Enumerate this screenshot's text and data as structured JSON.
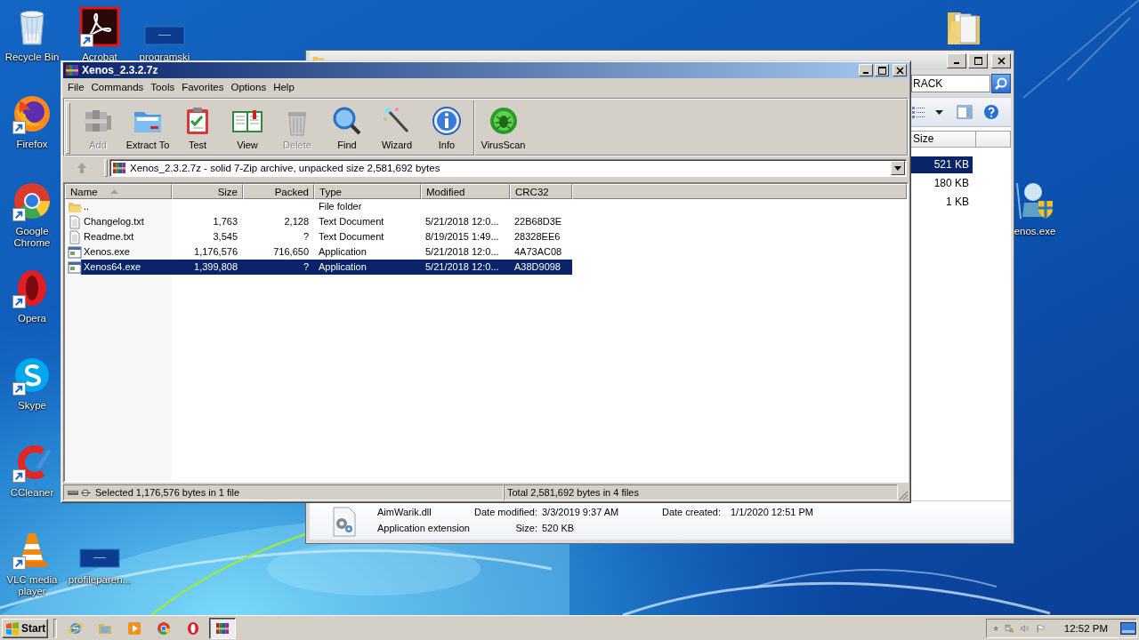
{
  "desktop": {
    "icons": [
      {
        "label": "Recycle Bin",
        "kind": "recycle",
        "shortcut": false
      },
      {
        "label": "Acrobat",
        "kind": "acrobat",
        "shortcut": true
      },
      {
        "label": "programski",
        "kind": "blank",
        "shortcut": false
      },
      {
        "label": "Firefox",
        "kind": "firefox",
        "shortcut": true
      },
      {
        "label": "Google Chrome",
        "kind": "chrome",
        "shortcut": true
      },
      {
        "label": "Opera",
        "kind": "opera",
        "shortcut": true
      },
      {
        "label": "Skype",
        "kind": "skype",
        "shortcut": true
      },
      {
        "label": "CCleaner",
        "kind": "ccleaner",
        "shortcut": true
      },
      {
        "label": "VLC media player",
        "kind": "vlc",
        "shortcut": true
      },
      {
        "label": "profileparen...",
        "kind": "blank",
        "shortcut": false
      },
      {
        "kind": "folder",
        "shortcut": false
      },
      {
        "label": "enos.exe",
        "kind": "figure",
        "shortcut": false
      }
    ]
  },
  "background_window": {
    "search": {
      "value": "RACK"
    },
    "columns": [
      "Size"
    ],
    "rows": [
      {
        "size": "521 KB",
        "selected": true
      },
      {
        "size": "180 KB",
        "selected": false
      },
      {
        "size": "1 KB",
        "selected": false
      }
    ],
    "details": {
      "name": "AimWarik.dll",
      "type": "Application extension",
      "fields": [
        {
          "label": "Date modified:",
          "value": "3/3/2019 9:37 AM"
        },
        {
          "label": "Date created:",
          "value": "1/1/2020 12:51 PM"
        },
        {
          "label": "Size:",
          "value": "520 KB"
        }
      ]
    }
  },
  "window": {
    "title": "Xenos_2.3.2.7z",
    "menu": [
      "File",
      "Commands",
      "Tools",
      "Favorites",
      "Options",
      "Help"
    ],
    "toolbar": [
      {
        "label": "Add",
        "kind": "add",
        "disabled": true,
        "separator_before": false
      },
      {
        "label": "Extract To",
        "kind": "extract",
        "disabled": false,
        "separator_before": false
      },
      {
        "label": "Test",
        "kind": "test",
        "disabled": false,
        "separator_before": false
      },
      {
        "label": "View",
        "kind": "view",
        "disabled": false,
        "separator_before": false
      },
      {
        "label": "Delete",
        "kind": "delete",
        "disabled": true,
        "separator_before": false
      },
      {
        "label": "Find",
        "kind": "find",
        "disabled": false,
        "separator_before": false
      },
      {
        "label": "Wizard",
        "kind": "wizard",
        "disabled": false,
        "separator_before": false
      },
      {
        "label": "Info",
        "kind": "info",
        "disabled": false,
        "separator_before": false
      },
      {
        "label": "VirusScan",
        "kind": "virusscan",
        "disabled": false,
        "separator_before": true
      }
    ],
    "address": "Xenos_2.3.2.7z - solid 7-Zip archive, unpacked size 2,581,692 bytes",
    "columns": [
      {
        "label": "Name",
        "kind": "text",
        "sorted": true
      },
      {
        "label": "Size",
        "kind": "number",
        "sorted": false
      },
      {
        "label": "Packed",
        "kind": "number",
        "sorted": false
      },
      {
        "label": "Type",
        "kind": "text",
        "sorted": false
      },
      {
        "label": "Modified",
        "kind": "text",
        "sorted": false
      },
      {
        "label": "CRC32",
        "kind": "text",
        "sorted": false
      }
    ],
    "rows": [
      {
        "kind": "folder",
        "name": "..",
        "type": "File folder",
        "selected": false
      },
      {
        "kind": "text",
        "name": "Changelog.txt",
        "size": "1,763",
        "packed": "2,128",
        "type": "Text Document",
        "modified": "5/21/2018 12:0...",
        "crc32": "22B68D3E",
        "selected": false
      },
      {
        "kind": "text",
        "name": "Readme.txt",
        "size": "3,545",
        "packed": "?",
        "type": "Text Document",
        "modified": "8/19/2015 1:49...",
        "crc32": "28328EE6",
        "selected": false
      },
      {
        "kind": "app",
        "name": "Xenos.exe",
        "size": "1,176,576",
        "packed": "716,650",
        "type": "Application",
        "modified": "5/21/2018 12:0...",
        "crc32": "4A73AC08",
        "selected": false
      },
      {
        "kind": "app",
        "name": "Xenos64.exe",
        "size": "1,399,808",
        "packed": "?",
        "type": "Application",
        "modified": "5/21/2018 12:0...",
        "crc32": "A38D9098",
        "selected": true
      }
    ],
    "status": [
      "Selected 1,176,576 bytes in 1 file",
      "Total 2,581,692 bytes in 4 files"
    ]
  },
  "taskbar": {
    "start": "Start",
    "apps": [
      {
        "kind": "ie",
        "active": false
      },
      {
        "kind": "explorer",
        "active": false
      },
      {
        "kind": "media",
        "active": false
      },
      {
        "kind": "chrome",
        "active": false
      },
      {
        "kind": "opera",
        "active": false
      },
      {
        "kind": "winrar",
        "active": true
      }
    ],
    "clock": "12:52 PM"
  }
}
